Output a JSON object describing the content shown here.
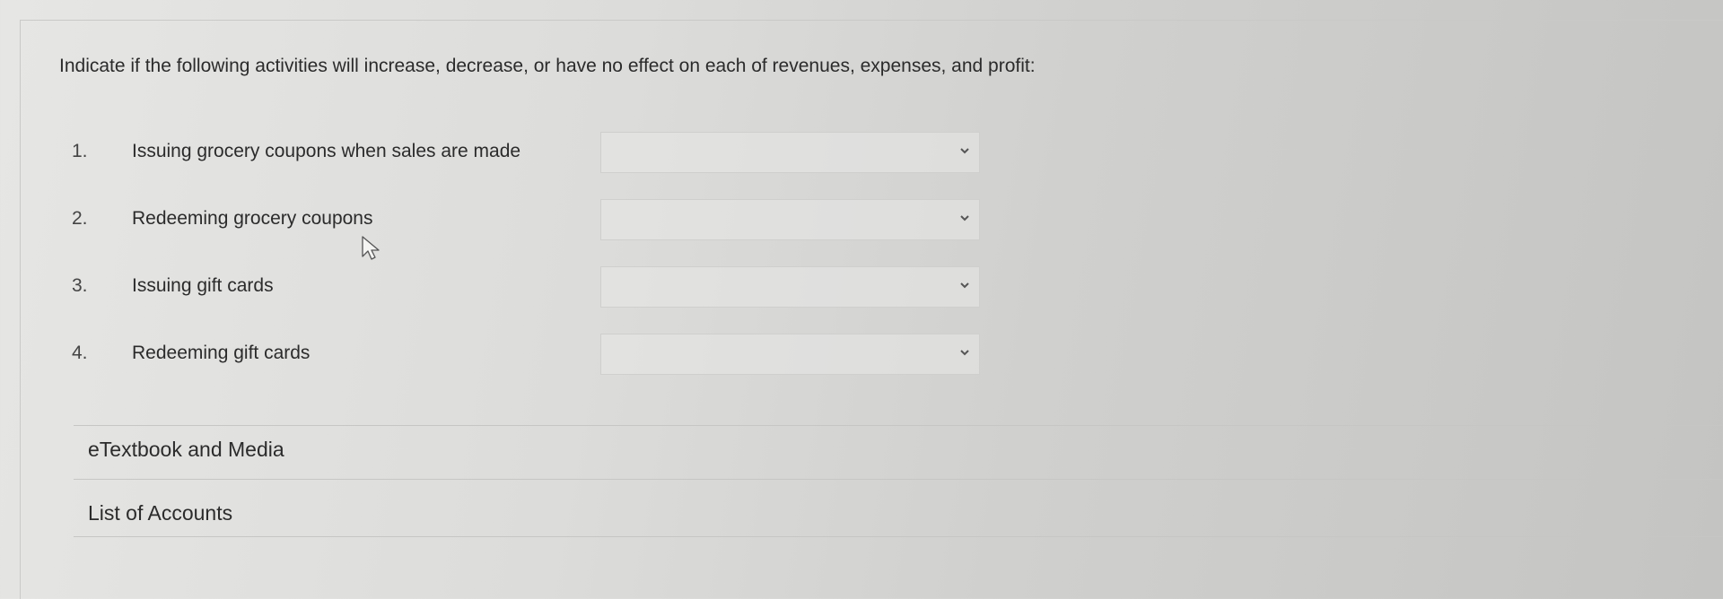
{
  "instructions": "Indicate if the following activities will increase, decrease, or have no effect on each of revenues, expenses, and profit:",
  "questions": [
    {
      "number": "1.",
      "text": "Issuing grocery coupons when sales are made",
      "selected": ""
    },
    {
      "number": "2.",
      "text": "Redeeming grocery coupons",
      "selected": ""
    },
    {
      "number": "3.",
      "text": "Issuing gift cards",
      "selected": ""
    },
    {
      "number": "4.",
      "text": "Redeeming gift cards",
      "selected": ""
    }
  ],
  "links": {
    "etextbook": "eTextbook and Media",
    "list_of_accounts": "List of Accounts"
  },
  "icons": {
    "dropdown": "chevron-down-icon",
    "cursor": "mouse-pointer-icon"
  }
}
